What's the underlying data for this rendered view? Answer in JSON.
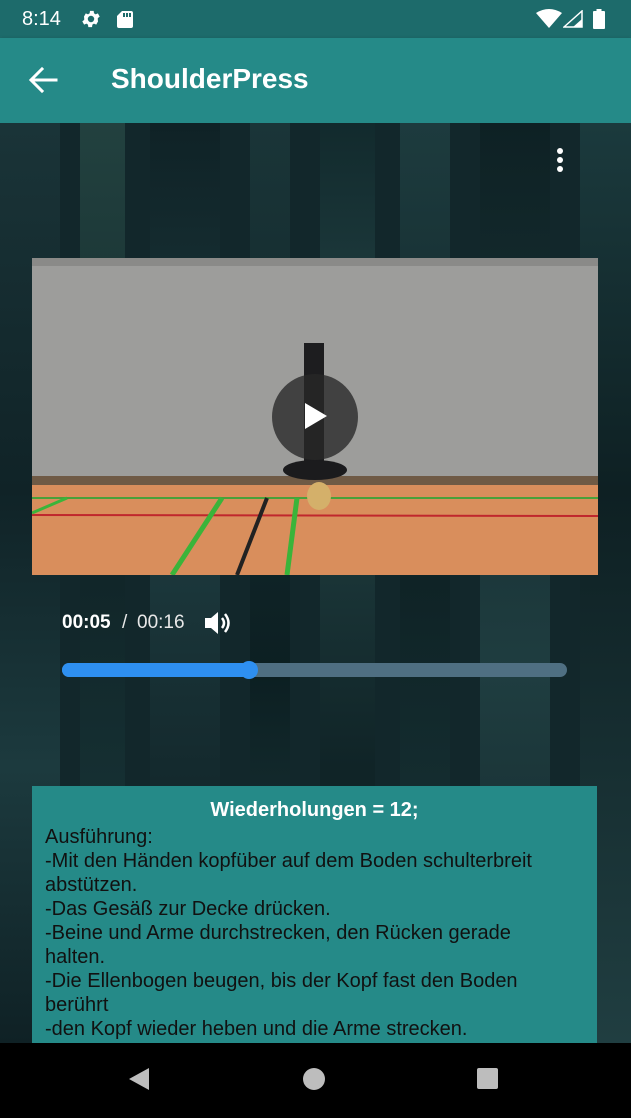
{
  "status_bar": {
    "time": "8:14",
    "icons": [
      "gear-icon",
      "sd-card-icon",
      "wifi-icon",
      "signal-icon",
      "battery-icon"
    ]
  },
  "app_bar": {
    "title": "ShoulderPress",
    "back_icon": "arrow-back-icon"
  },
  "overflow_menu_icon": "more-vert-icon",
  "video": {
    "play_icon": "play-icon",
    "current_time": "00:05",
    "separator": "/",
    "duration": "00:16",
    "volume_icon": "volume-icon",
    "progress": 0.37
  },
  "description": {
    "heading": "Wiederholungen = 12;",
    "lines": [
      "Ausführung:",
      " -Mit den Händen kopfüber auf dem Boden schulterbreit",
      "abstützen.",
      " -Das Gesäß zur Decke drücken.",
      " -Beine und Arme durchstrecken, den Rücken gerade",
      "halten.",
      " -Die Ellenbogen beugen, bis der Kopf fast den Boden",
      "berührt",
      " -den Kopf wieder heben und die Arme strecken."
    ]
  },
  "nav_bar": {
    "icons": [
      "back-triangle-icon",
      "home-circle-icon",
      "recents-square-icon"
    ]
  },
  "colors": {
    "app_bar": "#258a88",
    "status_bar": "#1d6b6b",
    "seek_fill": "#2e8ff0",
    "card": "#258a88"
  }
}
